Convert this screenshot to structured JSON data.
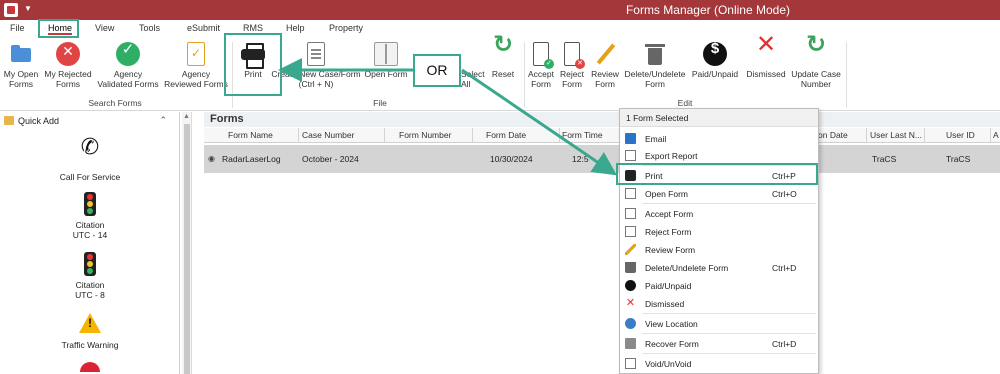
{
  "window": {
    "title": "Forms Manager (Online Mode)"
  },
  "menu": {
    "tabs": [
      {
        "label": "File"
      },
      {
        "label": "Home"
      },
      {
        "label": "View"
      },
      {
        "label": "Tools"
      },
      {
        "label": "eSubmit"
      },
      {
        "label": "RMS"
      },
      {
        "label": "Help"
      },
      {
        "label": "Property"
      }
    ],
    "active_tab": "Home"
  },
  "ribbon": {
    "search_forms": {
      "label": "Search Forms",
      "buttons": [
        {
          "line1": "My Open",
          "line2": "Forms",
          "icon": "folder-icon"
        },
        {
          "line1": "My Rejected",
          "line2": "Forms",
          "icon": "red-x-circle-icon"
        },
        {
          "line1": "Agency",
          "line2": "Validated Forms",
          "icon": "green-check-circle-icon"
        },
        {
          "line1": "Agency",
          "line2": "Reviewed Forms",
          "icon": "document-check-icon"
        }
      ]
    },
    "file": {
      "label": "File",
      "buttons": [
        {
          "line1": "Print",
          "line2": "",
          "icon": "printer-icon"
        },
        {
          "line1": "Create New Case/Form",
          "line2": "(Ctrl + N)",
          "icon": "new-document-icon"
        },
        {
          "line1": "Open Form",
          "line2": "",
          "icon": "open-book-icon"
        },
        {
          "line1": "Select",
          "line2": "All",
          "icon": "select-all-icon"
        },
        {
          "line1": "Reset",
          "line2": "",
          "icon": "reset-icon"
        }
      ]
    },
    "edit": {
      "label": "Edit",
      "buttons": [
        {
          "line1": "Accept",
          "line2": "Form",
          "icon": "accept-form-icon"
        },
        {
          "line1": "Reject",
          "line2": "Form",
          "icon": "reject-form-icon"
        },
        {
          "line1": "Review",
          "line2": "Form",
          "icon": "pencil-icon"
        },
        {
          "line1": "Delete/Undelete",
          "line2": "Form",
          "icon": "trash-icon"
        },
        {
          "line1": "Paid/Unpaid",
          "line2": "",
          "icon": "dollar-icon"
        },
        {
          "line1": "Dismissed",
          "line2": "",
          "icon": "big-x-icon"
        },
        {
          "line1": "Update Case",
          "line2": "Number",
          "icon": "refresh-icon"
        }
      ]
    }
  },
  "callout": {
    "or_label": "OR",
    "color": "#3aa88f"
  },
  "quick_add": {
    "title": "Quick Add",
    "items": [
      {
        "line1": "Call For Service",
        "line2": "",
        "icon": "phone-icon"
      },
      {
        "line1": "Citation",
        "line2": "UTC - 14",
        "icon": "traffic-light-icon"
      },
      {
        "line1": "Citation",
        "line2": "UTC - 8",
        "icon": "traffic-light-icon"
      },
      {
        "line1": "Traffic Warning",
        "line2": "",
        "icon": "warning-icon"
      }
    ]
  },
  "forms": {
    "title": "Forms",
    "columns": [
      "Form Name",
      "Case Number",
      "Form Number",
      "Form Date",
      "Form Time",
      "on Date",
      "User Last N...",
      "User ID",
      "A"
    ],
    "rows": [
      {
        "form_name": "RadarLaserLog",
        "case_number": "October - 2024",
        "form_number": "",
        "form_date": "10/30/2024",
        "form_time": "12:5",
        "user_last": "TraCS",
        "user_id": "TraCS"
      }
    ]
  },
  "context_menu": {
    "header": "1 Form Selected",
    "items": [
      {
        "label": "Email",
        "shortcut": "",
        "icon": "email-icon"
      },
      {
        "label": "Export Report",
        "shortcut": "",
        "icon": "export-report-icon"
      },
      {
        "label": "Print",
        "shortcut": "Ctrl+P",
        "icon": "printer-icon",
        "highlighted": true
      },
      {
        "label": "Open Form",
        "shortcut": "Ctrl+O",
        "icon": "open-form-icon"
      },
      {
        "label": "Accept Form",
        "shortcut": "",
        "icon": "accept-form-icon"
      },
      {
        "label": "Reject Form",
        "shortcut": "",
        "icon": "reject-form-icon"
      },
      {
        "label": "Review Form",
        "shortcut": "",
        "icon": "pencil-icon"
      },
      {
        "label": "Delete/Undelete Form",
        "shortcut": "Ctrl+D",
        "icon": "trash-icon"
      },
      {
        "label": "Paid/Unpaid",
        "shortcut": "",
        "icon": "dollar-icon"
      },
      {
        "label": "Dismissed",
        "shortcut": "",
        "icon": "red-x-icon"
      },
      {
        "label": "View Location",
        "shortcut": "",
        "icon": "globe-icon"
      },
      {
        "label": "Recover Form",
        "shortcut": "Ctrl+D",
        "icon": "recover-icon"
      },
      {
        "label": "Void/UnVoid",
        "shortcut": "",
        "icon": "void-icon"
      }
    ]
  },
  "colors": {
    "titlebar": "#a4373a",
    "highlight": "#3aa88f",
    "selected_row": "#d4d4d4"
  }
}
